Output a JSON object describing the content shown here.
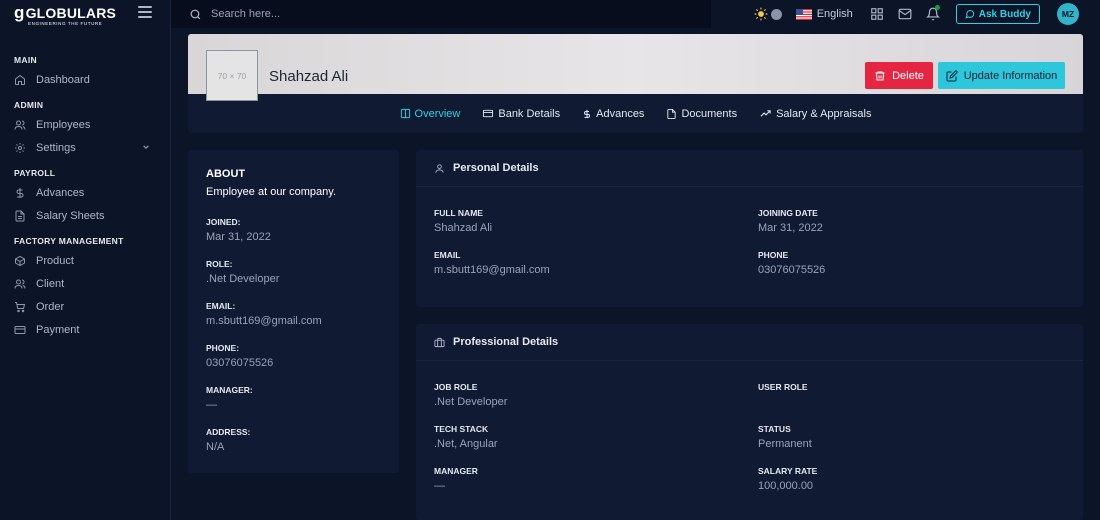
{
  "brand": {
    "name": "GLOBULARS",
    "tagline": "ENGINEERING THE FUTURE"
  },
  "sidebar": {
    "sections": [
      {
        "title": "MAIN",
        "items": [
          {
            "label": "Dashboard",
            "icon": "home-icon"
          }
        ]
      },
      {
        "title": "ADMIN",
        "items": [
          {
            "label": "Employees",
            "icon": "users-icon"
          },
          {
            "label": "Settings",
            "icon": "gear-icon"
          }
        ]
      },
      {
        "title": "PAYROLL",
        "items": [
          {
            "label": "Advances",
            "icon": "dollar-icon"
          },
          {
            "label": "Salary Sheets",
            "icon": "file-icon"
          }
        ]
      },
      {
        "title": "FACTORY MANAGEMENT",
        "items": [
          {
            "label": "Product",
            "icon": "box-icon"
          },
          {
            "label": "Client",
            "icon": "users-icon"
          },
          {
            "label": "Order",
            "icon": "cart-icon"
          },
          {
            "label": "Payment",
            "icon": "credit-card-icon"
          }
        ]
      }
    ]
  },
  "topbar": {
    "search_placeholder": "Search here...",
    "language": "English",
    "ask_label": "Ask Buddy",
    "avatar_initials": "MZ"
  },
  "profile": {
    "thumb_text": "70 × 70",
    "name": "Shahzad Ali",
    "delete_label": "Delete",
    "update_label": "Update Information",
    "tabs": [
      {
        "label": "Overview",
        "active": true
      },
      {
        "label": "Bank Details"
      },
      {
        "label": "Advances"
      },
      {
        "label": "Documents"
      },
      {
        "label": "Salary & Appraisals"
      }
    ]
  },
  "about": {
    "title": "ABOUT",
    "subtitle": "Employee at our company.",
    "fields": [
      {
        "label": "JOINED:",
        "value": "Mar 31, 2022"
      },
      {
        "label": "ROLE:",
        "value": ".Net Developer"
      },
      {
        "label": "EMAIL:",
        "value": "m.sbutt169@gmail.com"
      },
      {
        "label": "PHONE:",
        "value": "03076075526"
      },
      {
        "label": "MANAGER:",
        "value": "—"
      },
      {
        "label": "ADDRESS:",
        "value": "N/A"
      }
    ]
  },
  "personal": {
    "title": "Personal Details",
    "fields": [
      {
        "label": "FULL NAME",
        "value": "Shahzad Ali"
      },
      {
        "label": "JOINING DATE",
        "value": "Mar 31, 2022"
      },
      {
        "label": "EMAIL",
        "value": "m.sbutt169@gmail.com"
      },
      {
        "label": "PHONE",
        "value": "03076075526"
      }
    ]
  },
  "professional": {
    "title": "Professional Details",
    "fields": [
      {
        "label": "JOB ROLE",
        "value": ".Net Developer"
      },
      {
        "label": "USER ROLE",
        "value": ""
      },
      {
        "label": "TECH STACK",
        "value": ".Net, Angular"
      },
      {
        "label": "STATUS",
        "value": "Permanent"
      },
      {
        "label": "MANAGER",
        "value": "—"
      },
      {
        "label": "SALARY RATE",
        "value": "100,000.00"
      }
    ]
  },
  "colors": {
    "accent": "#2fd1e5",
    "danger": "#e42643",
    "info": "#2dc6db",
    "bg": "#0c1427",
    "card": "#101a33"
  }
}
